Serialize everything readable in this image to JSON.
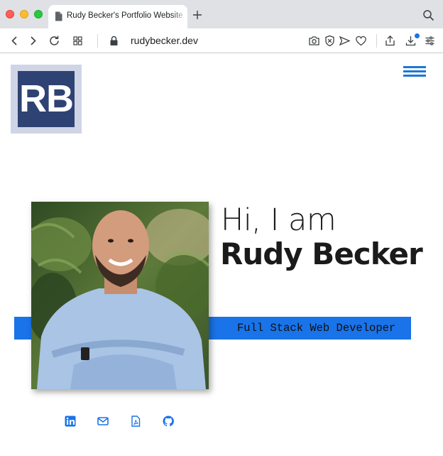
{
  "browser": {
    "tab_title": "Rudy Becker's Portfolio Website",
    "url": "rudybecker.dev"
  },
  "page": {
    "logo_text": "RB",
    "greeting": "Hi, I am",
    "name": "Rudy Becker",
    "subtitle": "Full Stack Web Developer",
    "accent_color": "#1a73e8",
    "social_links": [
      {
        "icon": "linkedin-icon"
      },
      {
        "icon": "mail-icon"
      },
      {
        "icon": "pdf-icon"
      },
      {
        "icon": "github-icon"
      }
    ]
  }
}
